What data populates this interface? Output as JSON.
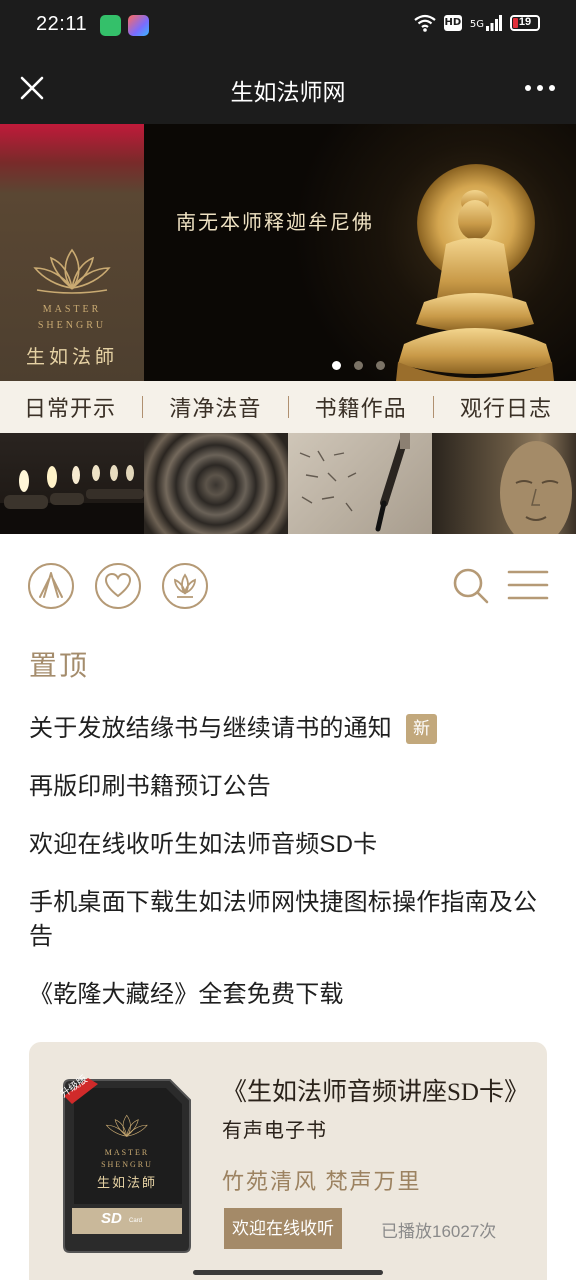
{
  "status_bar": {
    "time": "22:11",
    "hd": "HD",
    "network": "5G",
    "battery": "19",
    "battery_level": 0.19
  },
  "header": {
    "title": "生如法师网",
    "close_icon": "close-icon",
    "more_icon": "more-icon"
  },
  "banner": {
    "caption": "南无本师释迦牟尼佛",
    "logo_line1": "MASTER",
    "logo_line2": "SHENGRU",
    "logo_name": "生如法師",
    "active_slide": 1,
    "slide_count": 3
  },
  "nav": {
    "items": [
      "日常开示",
      "清净法音",
      "书籍作品",
      "观行日志"
    ]
  },
  "image_strip": {
    "tiles": [
      "candles-image",
      "incense-coil-image",
      "calligraphy-image",
      "buddha-statue-image"
    ]
  },
  "toolbar": {
    "icons": [
      "palms-together-icon",
      "heart-icon",
      "lotus-icon",
      "search-icon",
      "menu-icon"
    ]
  },
  "pinned": {
    "title": "置顶",
    "new_badge": "新",
    "items": [
      "关于发放结缘书与继续请书的通知",
      "再版印刷书籍预订公告",
      "欢迎在线收听生如法师音频SD卡",
      "手机桌面下载生如法师网快捷图标操作指南及公告",
      "《乾隆大藏经》全套免费下载"
    ]
  },
  "promo": {
    "title": "《生如法师音频讲座SD卡》",
    "subtitle": "有声电子书",
    "tagline": "竹苑清风 梵声万里",
    "button": "欢迎在线收听",
    "play_count": "已播放16027次",
    "card_badge": "升级版",
    "card_line1": "MASTER",
    "card_line2": "SHENGRU",
    "card_name": "生如法師",
    "card_brand": "SD",
    "card_small": "Card"
  },
  "colors": {
    "accent": "#b59a76",
    "badge": "#c2a87c",
    "dark_bar": "#1c1c1c"
  }
}
